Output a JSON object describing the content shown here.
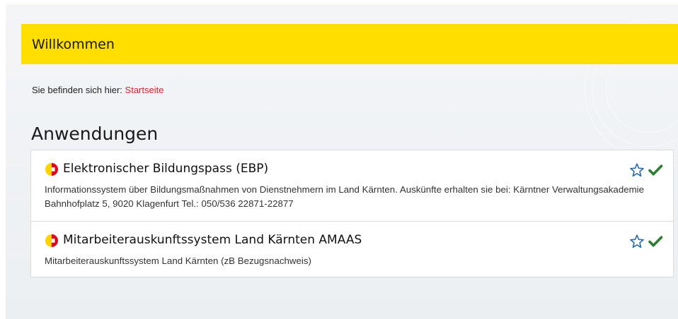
{
  "header": {
    "title": "Willkommen"
  },
  "breadcrumb": {
    "prefix": "Sie befinden sich hier:",
    "current": "Startseite"
  },
  "section": {
    "title": "Anwendungen"
  },
  "applications": [
    {
      "title": "Elektronischer Bildungspass (EBP)",
      "description": "Informationssystem über Bildungsmaßnahmen von Dienstnehmern im Land Kärnten. Auskünfte erhalten sie bei: Kärntner Verwaltungsakademie Bahnhofplatz 5, 9020 Klagenfurt Tel.: 050/536 22871-22877",
      "favorite": false,
      "enabled": true
    },
    {
      "title": "Mitarbeiterauskunftssystem Land Kärnten AMAAS",
      "description": "Mitarbeiterauskunftssystem Land Kärnten (zB Bezugsnachweis)",
      "favorite": false,
      "enabled": true
    }
  ],
  "colors": {
    "header_bar": "#ffde00",
    "link": "#d8232a",
    "star": "#2d6ca8",
    "check": "#2e7d32",
    "logo_yellow": "#ffd200",
    "logo_red": "#e2001a"
  }
}
